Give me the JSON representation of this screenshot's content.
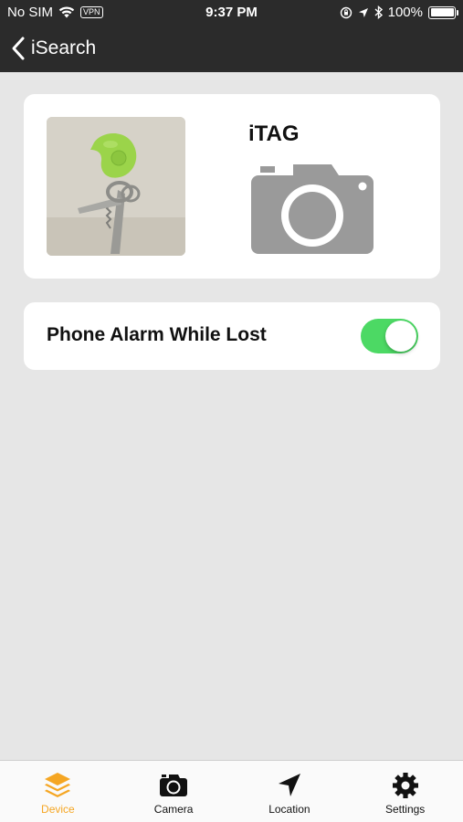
{
  "status_bar": {
    "carrier": "No SIM",
    "vpn": "VPN",
    "time": "9:37 PM",
    "battery": "100%"
  },
  "nav": {
    "back_label": "iSearch"
  },
  "device": {
    "name": "iTAG",
    "photo_icon": "camera-icon"
  },
  "settings": {
    "alarm_label": "Phone Alarm While Lost",
    "alarm_enabled": true
  },
  "tabs": [
    {
      "label": "Device",
      "icon": "layers-icon",
      "active": true
    },
    {
      "label": "Camera",
      "icon": "camera-icon",
      "active": false
    },
    {
      "label": "Location",
      "icon": "location-arrow-icon",
      "active": false
    },
    {
      "label": "Settings",
      "icon": "gear-icon",
      "active": false
    }
  ],
  "colors": {
    "accent": "#f5a623",
    "toggle_on": "#4cd964",
    "nav_bg": "#2b2b2b",
    "page_bg": "#e6e6e6"
  }
}
